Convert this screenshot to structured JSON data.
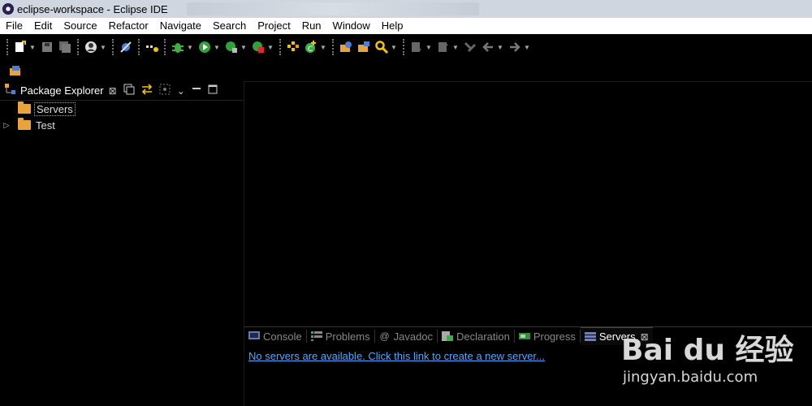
{
  "window": {
    "title": "eclipse-workspace - Eclipse IDE"
  },
  "menu": {
    "items": [
      "File",
      "Edit",
      "Source",
      "Refactor",
      "Navigate",
      "Search",
      "Project",
      "Run",
      "Window",
      "Help"
    ]
  },
  "toolbar": {
    "icons": [
      "new-icon",
      "save-icon",
      "save-all-icon",
      "profile-icon",
      "skip-breakpoints-icon",
      "debug-icon",
      "run-icon",
      "coverage-icon",
      "external-tools-icon",
      "new-class-icon",
      "open-type-icon",
      "search-icon",
      "annotation-icon",
      "back-icon",
      "forward-icon"
    ]
  },
  "package_explorer": {
    "title": "Package Explorer",
    "close_glyph": "⊠",
    "items": [
      {
        "label": "Servers",
        "expandable": false,
        "selected": true
      },
      {
        "label": "Test",
        "expandable": true,
        "selected": false
      }
    ]
  },
  "bottom_panel": {
    "tabs": [
      {
        "label": "Console",
        "active": false
      },
      {
        "label": "Problems",
        "active": false
      },
      {
        "label": "Javadoc",
        "active": false
      },
      {
        "label": "Declaration",
        "active": false
      },
      {
        "label": "Progress",
        "active": false
      },
      {
        "label": "Servers",
        "active": true
      }
    ],
    "link_text": "No servers are available. Click this link to create a new server..."
  },
  "watermark": {
    "logo": "Bai du 经验",
    "url": "jingyan.baidu.com"
  },
  "colors": {
    "link": "#4ea8ff",
    "folder": "#e8a33a",
    "active_tab": "#ffffff",
    "background": "#000000"
  }
}
